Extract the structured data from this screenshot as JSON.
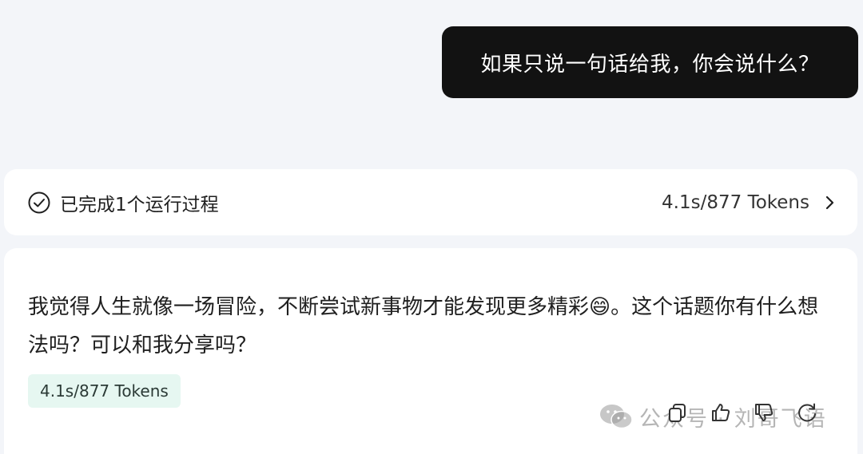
{
  "user_message": "如果只说一句话给我，你会说什么？",
  "process": {
    "label": "已完成1个运行过程",
    "stats": "4.1s/877 Tokens"
  },
  "answer": {
    "text": "我觉得人生就像一场冒险，不断尝试新事物才能发现更多精彩😄。这个话题你有什么想法吗？可以和我分享吗？",
    "token_badge": "4.1s/877 Tokens"
  },
  "actions": {
    "icons": [
      "copy-icon",
      "thumbs-up-icon",
      "thumbs-down-icon",
      "regenerate-icon"
    ]
  },
  "watermark": {
    "text": "公众号 · 刘哥飞语",
    "icon": "wechat-icon"
  },
  "colors": {
    "page_bg": "#f3f5f9",
    "user_bubble_bg": "#121212",
    "card_bg": "#ffffff",
    "token_badge_bg": "#e6f7f1"
  }
}
